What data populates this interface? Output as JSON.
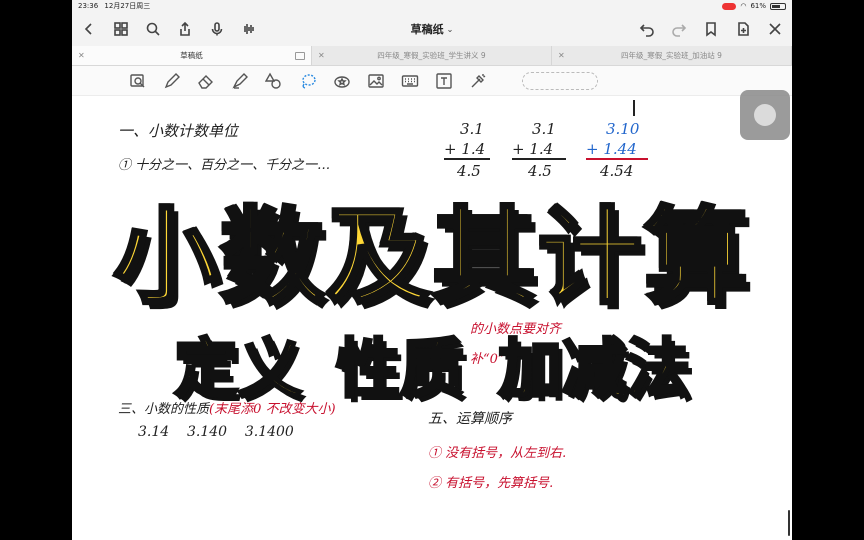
{
  "status": {
    "time": "23:36",
    "date": "12月27日周三",
    "battery": "61%"
  },
  "navbar": {
    "title": "草稿纸",
    "title_chevron": "⌄",
    "left_icons": [
      "back-icon",
      "grid-icon",
      "search-icon",
      "share-icon",
      "mic-icon",
      "waveform-icon"
    ],
    "right_icons": [
      "undo-icon",
      "redo-icon",
      "bookmark-icon",
      "add-page-icon",
      "close-icon"
    ]
  },
  "tabs": [
    {
      "label": "草稿纸",
      "active": true
    },
    {
      "label": "四年级_寒假_实验班_学生讲义 9",
      "active": false
    },
    {
      "label": "四年级_寒假_实验班_加油站 9",
      "active": false
    }
  ],
  "toolbar": {
    "tools": [
      "zoom-box-icon",
      "pen-icon",
      "eraser-icon",
      "highlighter-icon",
      "shapes-icon",
      "lasso-icon",
      "sticker-icon",
      "image-icon",
      "keyboard-icon",
      "text-icon",
      "laser-icon"
    ],
    "selected_tool": "lasso-icon"
  },
  "notes": {
    "h1": "一、小数计数单位",
    "h1_item": "① 十分之一、百分之一、千分之一…",
    "calc1_top": "3.1",
    "calc1_mid": "+ 1.4",
    "calc1_bot": "4.5",
    "calc2_top": "3.1",
    "calc2_mid": "+ 1.4",
    "calc2_bot": "4.5",
    "calc3_top": "3.10",
    "calc3_mid": "+ 1.44",
    "calc3_bot": "4.54",
    "rule_line1": "的小数点要对齐",
    "rule_line2": "补“0”",
    "h3": "三、小数的性质",
    "h3_note": "(末尾添0 不改变大小)",
    "h3_values": "3.14    3.140    3.1400",
    "h5": "五、运算顺序",
    "h5_item1": "① 没有括号，从左到右.",
    "h5_item2": "② 有括号，先算括号."
  },
  "overlay": {
    "title": "小数及其计算",
    "subtitles": [
      "定义",
      "性质",
      "加减法"
    ]
  },
  "colors": {
    "title_fill": "#ffd836",
    "title_stroke": "#111111",
    "ink_red": "#c8102e",
    "ink_blue": "#2266cc"
  }
}
